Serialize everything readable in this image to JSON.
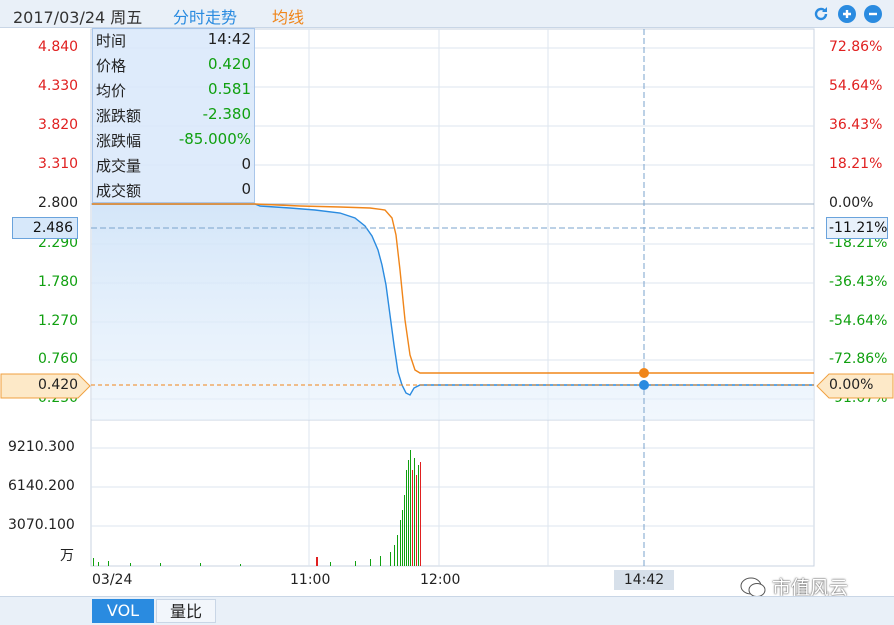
{
  "header": {
    "date": "2017/03/24 周五",
    "tab_intraday": "分时走势",
    "tab_avg": "均线",
    "refresh_icon": "refresh-icon",
    "zoom_in_icon": "plus-icon",
    "zoom_out_icon": "minus-icon"
  },
  "left_axis": [
    "4.840",
    "4.330",
    "3.820",
    "3.310",
    "2.800",
    "2.290",
    "1.780",
    "1.270",
    "0.760",
    "0.250"
  ],
  "right_axis": [
    "72.86%",
    "54.64%",
    "36.43%",
    "18.21%",
    "0.00%",
    "-18.21%",
    "-36.43%",
    "-54.64%",
    "-72.86%",
    "-91.07%"
  ],
  "crosshair": {
    "price_left": "2.486",
    "pct_right": "-11.21%",
    "time": "14:42",
    "last_price": "0.420",
    "last_pct": "0.00%"
  },
  "tooltip": {
    "rows": [
      {
        "k": "时间",
        "v": "14:42"
      },
      {
        "k": "价格",
        "v": "0.420"
      },
      {
        "k": "均价",
        "v": "0.581"
      },
      {
        "k": "涨跌额",
        "v": "-2.380"
      },
      {
        "k": "涨跌幅",
        "v": "-85.000%"
      },
      {
        "k": "成交量",
        "v": "0"
      },
      {
        "k": "成交额",
        "v": "0"
      }
    ]
  },
  "volume_axis": [
    "9210.300",
    "6140.200",
    "3070.100",
    "万"
  ],
  "time_axis": {
    "start": "03/24",
    "t1": "11:00",
    "t2": "12:00"
  },
  "bottom_tabs": {
    "vol": "VOL",
    "ratio": "量比"
  },
  "watermark": "市值风云",
  "colors": {
    "price_line": "#2a8be0",
    "avg_line": "#f08519",
    "up": "#e02020",
    "down": "#10a010"
  }
}
